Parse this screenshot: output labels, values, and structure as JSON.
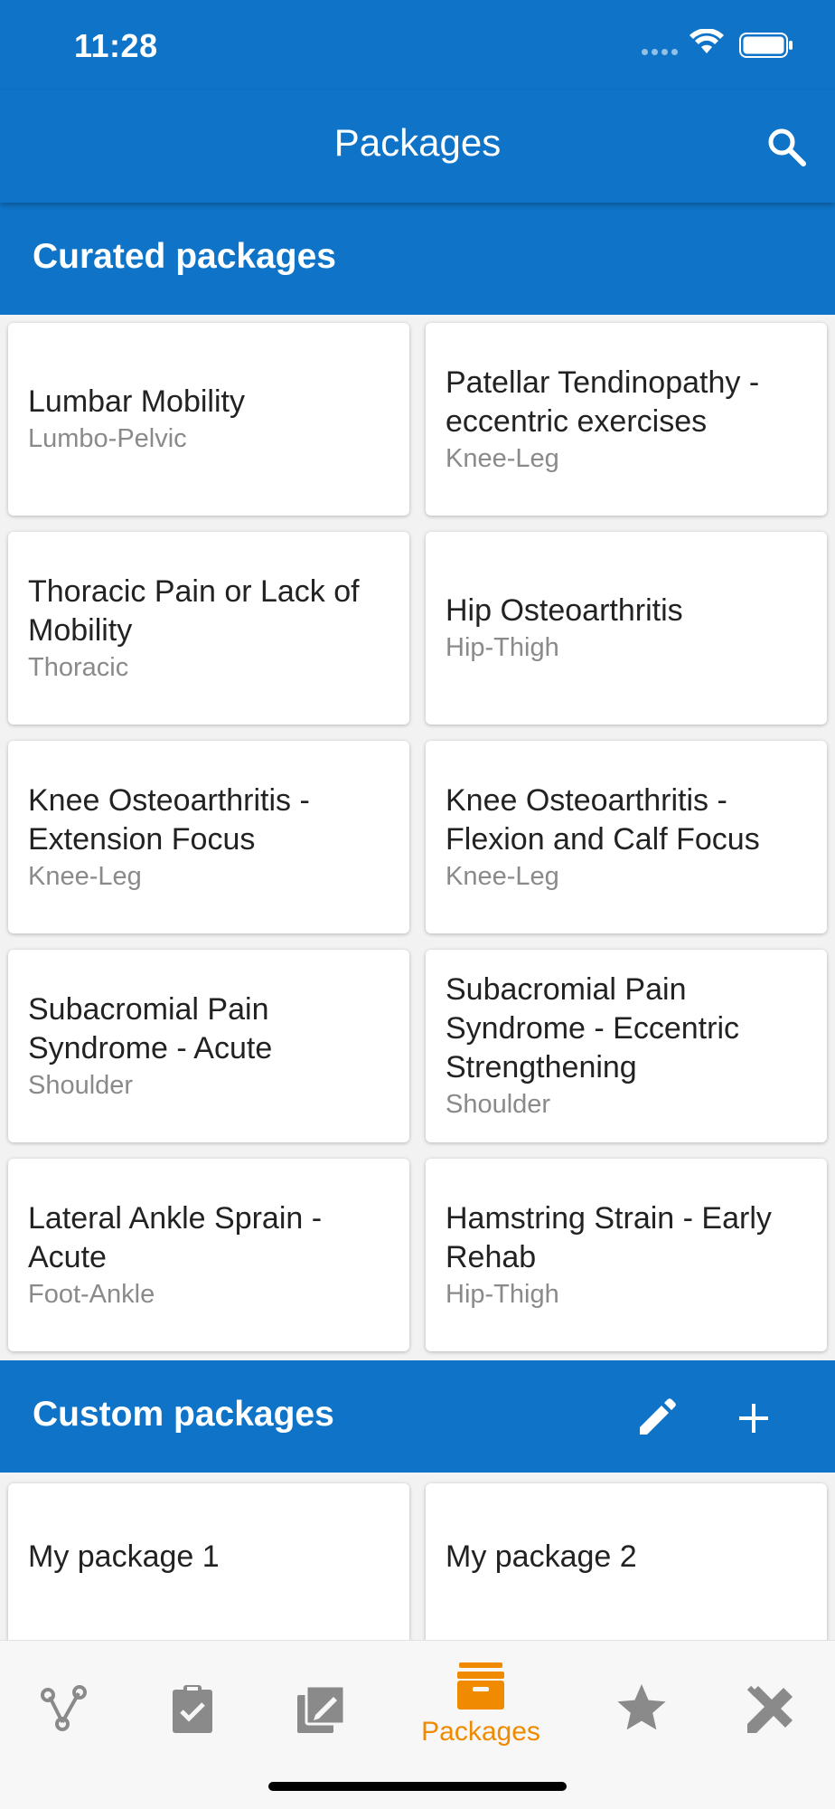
{
  "status_bar": {
    "time": "11:28"
  },
  "app_bar": {
    "title": "Packages",
    "search_icon": "search-icon"
  },
  "curated": {
    "title": "Curated packages",
    "packages": [
      {
        "name": "Lumbar Mobility",
        "category": "Lumbo-Pelvic"
      },
      {
        "name": "Patellar Tendinopathy  - eccentric exercises",
        "category": "Knee-Leg"
      },
      {
        "name": "Thoracic Pain or Lack of Mobility",
        "category": "Thoracic"
      },
      {
        "name": "Hip Osteoarthritis",
        "category": "Hip-Thigh"
      },
      {
        "name": "Knee Osteoarthritis - Extension Focus",
        "category": "Knee-Leg"
      },
      {
        "name": "Knee Osteoarthritis - Flexion and Calf Focus",
        "category": "Knee-Leg"
      },
      {
        "name": "Subacromial Pain Syndrome - Acute",
        "category": "Shoulder"
      },
      {
        "name": "Subacromial Pain Syndrome - Eccentric Strengthening",
        "category": "Shoulder"
      },
      {
        "name": "Lateral Ankle Sprain - Acute",
        "category": "Foot-Ankle"
      },
      {
        "name": "Hamstring Strain - Early Rehab",
        "category": "Hip-Thigh"
      }
    ]
  },
  "custom": {
    "title": "Custom packages",
    "packages": [
      {
        "name": "My package 1"
      },
      {
        "name": "My package 2"
      }
    ]
  },
  "bottom_nav": {
    "active_label": "Packages",
    "items": [
      "graph-icon",
      "clipboard-icon",
      "edit-note-icon",
      "archive-box-icon",
      "star-icon",
      "tools-icon"
    ]
  },
  "colors": {
    "primary": "#0f74c8",
    "accent": "#f08a00",
    "inactive_icon": "#8a8a8a"
  }
}
